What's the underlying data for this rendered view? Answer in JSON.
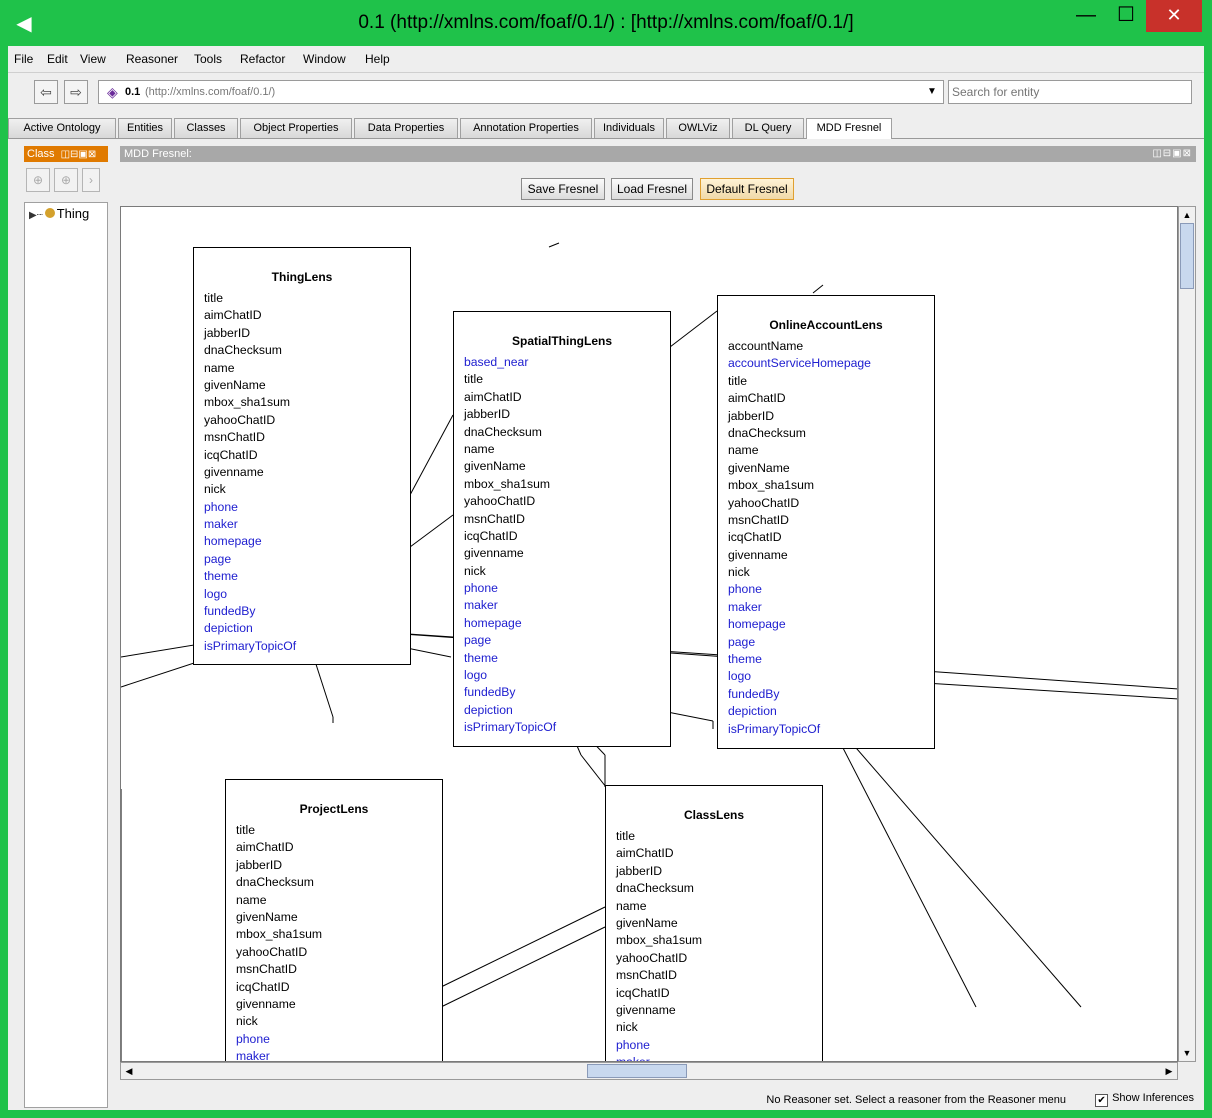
{
  "window": {
    "title": "0.1 (http://xmlns.com/foaf/0.1/)  : [http://xmlns.com/foaf/0.1/]",
    "min": "—",
    "max": "☐",
    "close": "✕",
    "app_icon": "◀"
  },
  "menu": [
    "File",
    "Edit",
    "View",
    "Reasoner",
    "Tools",
    "Refactor",
    "Window",
    "Help"
  ],
  "toolbar": {
    "back": "⇦",
    "forward": "⇨",
    "ontology_name": "0.1",
    "ontology_iri": "(http://xmlns.com/foaf/0.1/)",
    "search_placeholder": "Search for entity"
  },
  "tabs": [
    "Active Ontology",
    "Entities",
    "Classes",
    "Object Properties",
    "Data Properties",
    "Annotation Properties",
    "Individuals",
    "OWLViz",
    "DL Query",
    "MDD Fresnel"
  ],
  "active_tab": "MDD Fresnel",
  "class_panel": {
    "header": "Class",
    "header_icons": "◫⊟▣⊠",
    "root": "Thing"
  },
  "mdd": {
    "header": "MDD Fresnel:",
    "header_icons": "◫⊟▣⊠",
    "buttons": {
      "save": "Save Fresnel",
      "load": "Load Fresnel",
      "default": "Default Fresnel"
    }
  },
  "lenses": {
    "thing": {
      "title": "ThingLens",
      "props": [
        "title",
        "aimChatID",
        "jabberID",
        "dnaChecksum",
        "name",
        "givenName",
        "mbox_sha1sum",
        "yahooChatID",
        "msnChatID",
        "icqChatID",
        "givenname",
        "nick",
        "phone",
        "maker",
        "homepage",
        "page",
        "theme",
        "logo",
        "fundedBy",
        "depiction",
        "isPrimaryTopicOf"
      ]
    },
    "spatial": {
      "title": "SpatialThingLens",
      "props": [
        "based_near",
        "title",
        "aimChatID",
        "jabberID",
        "dnaChecksum",
        "name",
        "givenName",
        "mbox_sha1sum",
        "yahooChatID",
        "msnChatID",
        "icqChatID",
        "givenname",
        "nick",
        "phone",
        "maker",
        "homepage",
        "page",
        "theme",
        "logo",
        "fundedBy",
        "depiction",
        "isPrimaryTopicOf"
      ]
    },
    "online": {
      "title": "OnlineAccountLens",
      "props": [
        "accountName",
        "accountServiceHomepage",
        "title",
        "aimChatID",
        "jabberID",
        "dnaChecksum",
        "name",
        "givenName",
        "mbox_sha1sum",
        "yahooChatID",
        "msnChatID",
        "icqChatID",
        "givenname",
        "nick",
        "phone",
        "maker",
        "homepage",
        "page",
        "theme",
        "logo",
        "fundedBy",
        "depiction",
        "isPrimaryTopicOf"
      ]
    },
    "project": {
      "title": "ProjectLens",
      "props": [
        "title",
        "aimChatID",
        "jabberID",
        "dnaChecksum",
        "name",
        "givenName",
        "mbox_sha1sum",
        "yahooChatID",
        "msnChatID",
        "icqChatID",
        "givenname",
        "nick",
        "phone",
        "maker"
      ]
    },
    "class": {
      "title": "ClassLens",
      "props": [
        "title",
        "aimChatID",
        "jabberID",
        "dnaChecksum",
        "name",
        "givenName",
        "mbox_sha1sum",
        "yahooChatID",
        "msnChatID",
        "icqChatID",
        "givenname",
        "nick",
        "phone",
        "maker"
      ]
    }
  },
  "object_properties": [
    "based_near",
    "accountServiceHomepage",
    "phone",
    "maker",
    "homepage",
    "page",
    "theme",
    "logo",
    "fundedBy",
    "depiction",
    "isPrimaryTopicOf"
  ],
  "status": {
    "text": "No Reasoner set. Select a reasoner from the Reasoner menu",
    "show_inferences": "Show Inferences",
    "checked": "✔"
  }
}
